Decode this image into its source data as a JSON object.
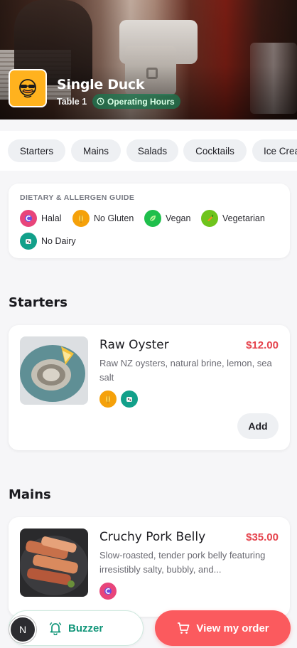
{
  "restaurant": {
    "name": "Single Duck",
    "table": "Table 1",
    "hours_label": "Operating Hours",
    "logo_icon": "duck-sunglasses-icon"
  },
  "categories": [
    "Starters",
    "Mains",
    "Salads",
    "Cocktails",
    "Ice Crea"
  ],
  "dietary_guide": {
    "title": "DIETARY & ALLERGEN GUIDE",
    "items": [
      {
        "label": "Halal",
        "icon": "halal-icon",
        "color": "#e8457a"
      },
      {
        "label": "No Gluten",
        "icon": "wheat-icon",
        "color": "#f5a10a"
      },
      {
        "label": "Vegan",
        "icon": "leaf-icon",
        "color": "#1fbf4c"
      },
      {
        "label": "Vegetarian",
        "icon": "carrot-icon",
        "color": "#6fc41c"
      },
      {
        "label": "No Dairy",
        "icon": "cow-icon",
        "color": "#12a08a"
      }
    ]
  },
  "sections": [
    {
      "title": "Starters",
      "items": [
        {
          "name": "Raw Oyster",
          "price": "$12.00",
          "description": "Raw NZ oysters, natural brine, lemon, sea salt",
          "badges": [
            "wheat-icon",
            "cow-icon"
          ],
          "add_label": "Add"
        }
      ]
    },
    {
      "title": "Mains",
      "items": [
        {
          "name": "Cruchy Pork Belly",
          "price": "$35.00",
          "description": "Slow-roasted, tender pork belly featuring irresistibly salty, bubbly, and...",
          "badges": [
            "halal-icon"
          ]
        }
      ]
    }
  ],
  "bottom_bar": {
    "avatar_initial": "N",
    "buzzer_label": "Buzzer",
    "order_label": "View my order",
    "accent_color": "#fb5a5e"
  }
}
